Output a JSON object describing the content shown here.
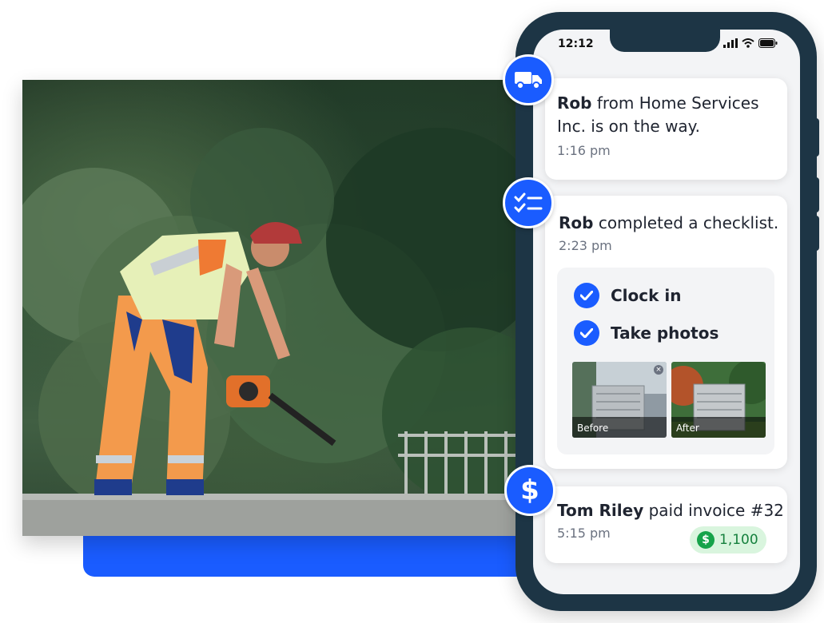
{
  "status_bar": {
    "time": "12:12"
  },
  "notifications": {
    "on_the_way": {
      "name": "Rob",
      "text": " from Home Services Inc. is on the way.",
      "time": "1:16 pm"
    },
    "checklist": {
      "name": "Rob",
      "text": " completed a checklist.",
      "time": "2:23 pm",
      "items": [
        "Clock in",
        "Take photos"
      ],
      "photos": [
        {
          "label": "Before"
        },
        {
          "label": "After"
        }
      ]
    },
    "invoice": {
      "name": "Tom Riley",
      "text": " paid invoice #32",
      "time": "5:15 pm",
      "currency_symbol": "$",
      "amount": "1,100"
    }
  },
  "icons": {
    "truck": "truck-icon",
    "checklist": "checklist-icon",
    "dollar": "dollar-icon"
  },
  "colors": {
    "accent": "#1a5cff",
    "phone_frame": "#1d3545",
    "paid_green": "#16a34a"
  }
}
